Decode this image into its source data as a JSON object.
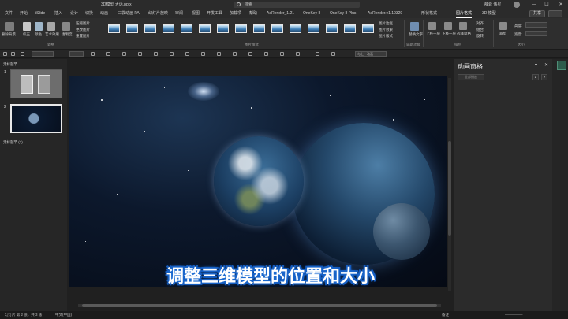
{
  "window": {
    "doc_name": "3D模型  大话.pptx",
    "search_placeholder": "搜索",
    "user_name": "薛蓉 伟星",
    "minimize": "—",
    "maximize": "☐",
    "close": "✕"
  },
  "tabs": [
    "文件",
    "开始",
    "iSlide",
    "插入",
    "设计",
    "切换",
    "动画",
    "口袋动画 PA",
    "幻灯片放映",
    "审阅",
    "视图",
    "开发工具",
    "加载项",
    "帮助",
    "AeRender_1.21",
    "OneKey 8",
    "OneKey 8 Plus",
    "AeRender.v1.10329",
    "形状格式",
    "图片格式",
    "3D 模型"
  ],
  "active_tab": "图片格式",
  "share_label": "共享",
  "ribbon": {
    "remove_bg": "删除背景",
    "corrections": "校正",
    "color": "颜色",
    "artistic_effects": "艺术效果",
    "transparency": "透明度",
    "compress": "压缩图片",
    "change": "更改图片",
    "reset": "重置图片",
    "adjust_group": "调整",
    "styles_group": "图片样式",
    "border": "图片边框",
    "effects": "图片效果",
    "layout": "图片版式",
    "alt_text": "替换文字",
    "accessibility_group": "辅助功能",
    "forward": "上移一层",
    "backward": "下移一层",
    "selection_pane": "选择窗格",
    "align": "对齐",
    "group": "组合",
    "rotate": "旋转",
    "arrange_group": "排列",
    "crop": "裁剪",
    "height_label": "高度:",
    "width_label": "宽度:",
    "size_group": "大小"
  },
  "qbar": {
    "zoom_box": "与上一动画",
    "font_box": ""
  },
  "thumbnails": {
    "section1": "无标题节",
    "slide1_num": "1",
    "slide2_num": "2",
    "section2": "无标题节 (1)"
  },
  "slide": {
    "subtitle": "调整三维模型的位置和大小"
  },
  "animation_pane": {
    "title": "动画窗格",
    "play_label": "全部播放",
    "dropdown": "▾",
    "close": "✕",
    "up": "▲",
    "down": "▼"
  },
  "status": {
    "slide_info": "幻灯片 第 2 张，共 3 张",
    "language": "中文(中国)",
    "notes": "备注",
    "zoom": "—————"
  }
}
